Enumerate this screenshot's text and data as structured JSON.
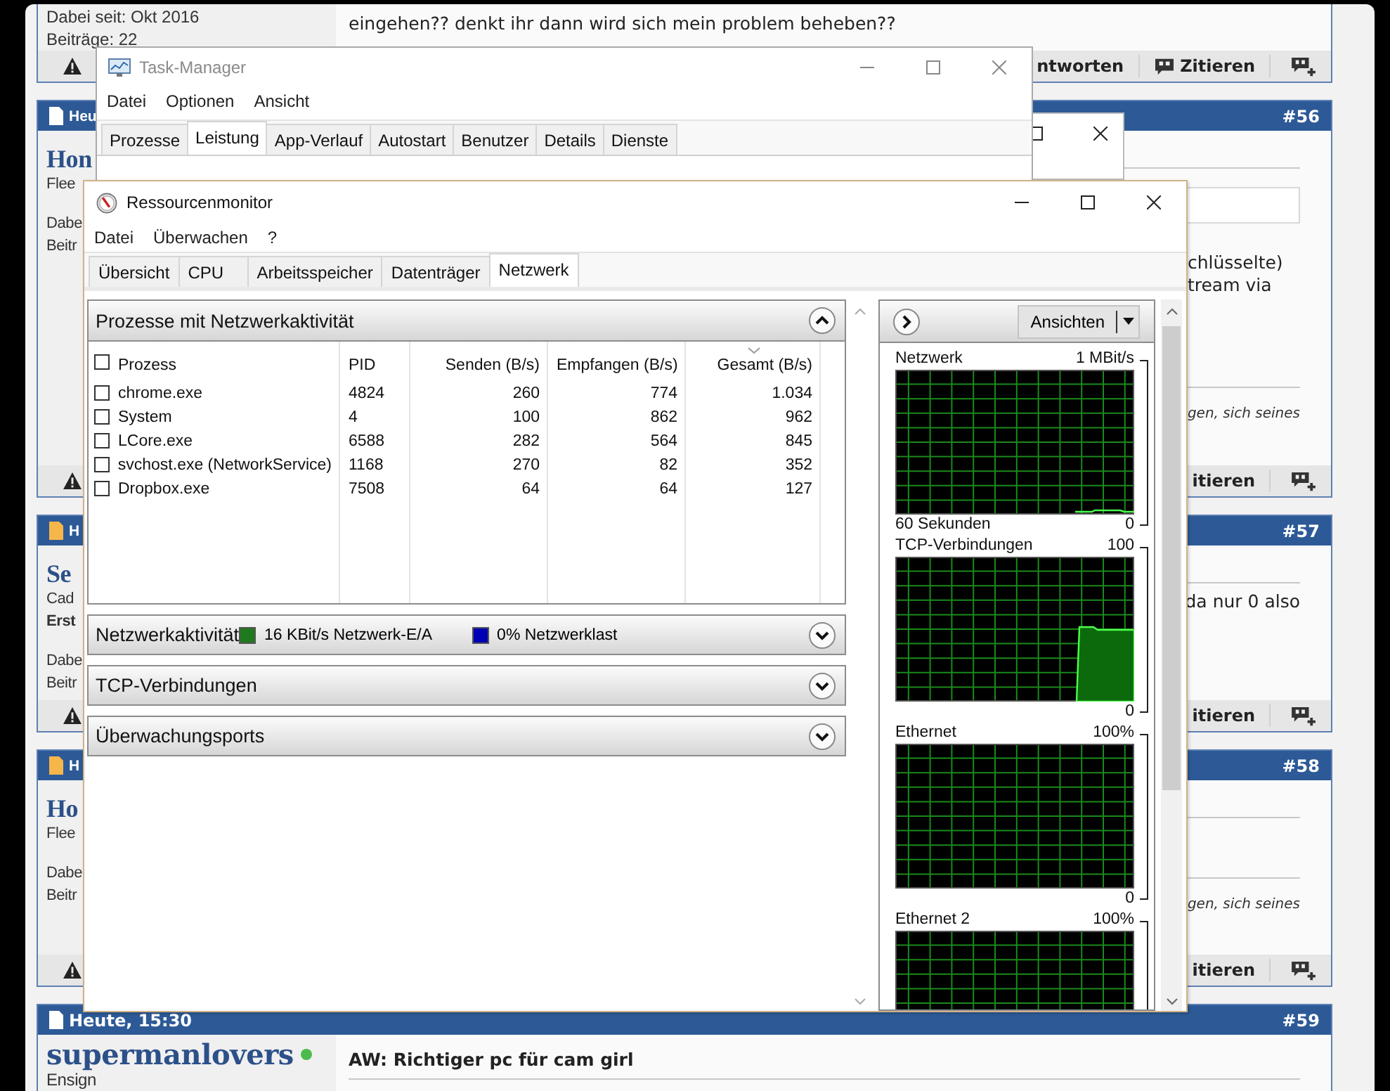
{
  "forum": {
    "posts": [
      {
        "kind": "top",
        "meta": [
          "Dabei seit: Okt 2016",
          "Beiträge: 22"
        ],
        "blocks": [
          {
            "kind": "text",
            "text": "eingehen?? denkt ihr dann wird sich mein problem beheben??"
          }
        ],
        "footer": {
          "reply": "ntworten",
          "quote": "Zitieren",
          "quote_icon": true
        }
      },
      {
        "kind": "covered",
        "time": "Heu",
        "unread": false,
        "number": "#56",
        "name": "Hon",
        "rank": "Flee",
        "meta": [
          "Dabe",
          "Beitr"
        ],
        "blocks": [
          {
            "kind": "rule"
          },
          {
            "kind": "box"
          },
          {
            "kind": "text",
            "text": "chlüsselte)"
          },
          {
            "kind": "text",
            "text": "tream via"
          },
          {
            "kind": "rule"
          },
          {
            "kind": "signature",
            "text": "gen, sich seines"
          }
        ],
        "footer": {
          "quote": "itieren",
          "quote_icon": false
        }
      },
      {
        "kind": "covered",
        "time": "H",
        "unread": true,
        "number": "#57",
        "name": "Se",
        "rank": "Cad",
        "title": "Erst",
        "meta": [
          "Dabe",
          "Beitr"
        ],
        "blocks": [
          {
            "kind": "rule"
          },
          {
            "kind": "text",
            "text": "da nur 0 also"
          }
        ],
        "footer": {
          "quote": "itieren",
          "quote_icon": false
        }
      },
      {
        "kind": "covered",
        "time": "H",
        "unread": true,
        "number": "#58",
        "name": "Ho",
        "rank": "Flee",
        "meta": [
          "Dabe",
          "Beitr"
        ],
        "blocks": [
          {
            "kind": "rule"
          },
          {
            "kind": "rule"
          },
          {
            "kind": "signature",
            "text": "gen, sich seines"
          }
        ],
        "footer": {
          "quote": "itieren",
          "quote_icon": false
        }
      },
      {
        "kind": "open",
        "time": "Heute, 15:30",
        "unread": false,
        "number": "#59",
        "name": "supermanlovers",
        "online": true,
        "rank": "Ensign",
        "subject": "AW: Richtiger pc für cam girl",
        "blocks": [
          {
            "kind": "rule"
          }
        ]
      }
    ]
  },
  "task_manager": {
    "title": "Task-Manager",
    "menu": [
      "Datei",
      "Optionen",
      "Ansicht"
    ],
    "tabs": [
      {
        "label": "Prozesse",
        "selected": false
      },
      {
        "label": "Leistung",
        "selected": true
      },
      {
        "label": "App-Verlauf",
        "selected": false
      },
      {
        "label": "Autostart",
        "selected": false
      },
      {
        "label": "Benutzer",
        "selected": false
      },
      {
        "label": "Details",
        "selected": false
      },
      {
        "label": "Dienste",
        "selected": false
      }
    ]
  },
  "resmon": {
    "title": "Ressourcenmonitor",
    "menu": [
      "Datei",
      "Überwachen",
      "?"
    ],
    "tabs": [
      {
        "label": "Übersicht",
        "selected": false
      },
      {
        "label": "CPU",
        "selected": false
      },
      {
        "label": "Arbeitsspeicher",
        "selected": false
      },
      {
        "label": "Datenträger",
        "selected": false
      },
      {
        "label": "Netzwerk",
        "selected": true
      }
    ],
    "processes": {
      "title": "Prozesse mit Netzwerkaktivität",
      "expanded": true,
      "all_checked": false,
      "columns": [
        {
          "label": "Prozess",
          "sorted": false
        },
        {
          "label": "PID",
          "sorted": false
        },
        {
          "label": "Senden (B/s)",
          "sorted": false
        },
        {
          "label": "Empfangen (B/s)",
          "sorted": false
        },
        {
          "label": "Gesamt (B/s)",
          "sorted": true
        }
      ],
      "rows": [
        {
          "checked": false,
          "cells": [
            "chrome.exe",
            "4824",
            "260",
            "774",
            "1.034"
          ]
        },
        {
          "checked": false,
          "cells": [
            "System",
            "4",
            "100",
            "862",
            "962"
          ]
        },
        {
          "checked": false,
          "cells": [
            "LCore.exe",
            "6588",
            "282",
            "564",
            "845"
          ]
        },
        {
          "checked": false,
          "cells": [
            "svchost.exe (NetworkService)",
            "1168",
            "270",
            "82",
            "352"
          ]
        },
        {
          "checked": false,
          "cells": [
            "Dropbox.exe",
            "7508",
            "64",
            "64",
            "127"
          ]
        }
      ]
    },
    "sections": [
      {
        "title": "Netzwerkaktivität",
        "expanded": false,
        "legend": [
          {
            "color": "#1f7a1f",
            "text": "16 KBit/s Netzwerk-E/A"
          },
          {
            "color": "#0000b4",
            "text": "0% Netzwerklast"
          }
        ]
      },
      {
        "title": "TCP-Verbindungen",
        "expanded": false
      },
      {
        "title": "Überwachungsports",
        "expanded": false
      }
    ],
    "views_button": "Ansichten",
    "graphs": [
      {
        "title": "Netzwerk",
        "max": "1 MBit/s",
        "footer": "60 Sekunden",
        "min": "0",
        "kind": "low_line"
      },
      {
        "title": "TCP-Verbindungen",
        "max": "100",
        "min": "0",
        "kind": "step_area"
      },
      {
        "title": "Ethernet",
        "max": "100%",
        "min": "0",
        "kind": "none"
      },
      {
        "title": "Ethernet 2",
        "max": "100%",
        "kind": "none"
      }
    ]
  }
}
